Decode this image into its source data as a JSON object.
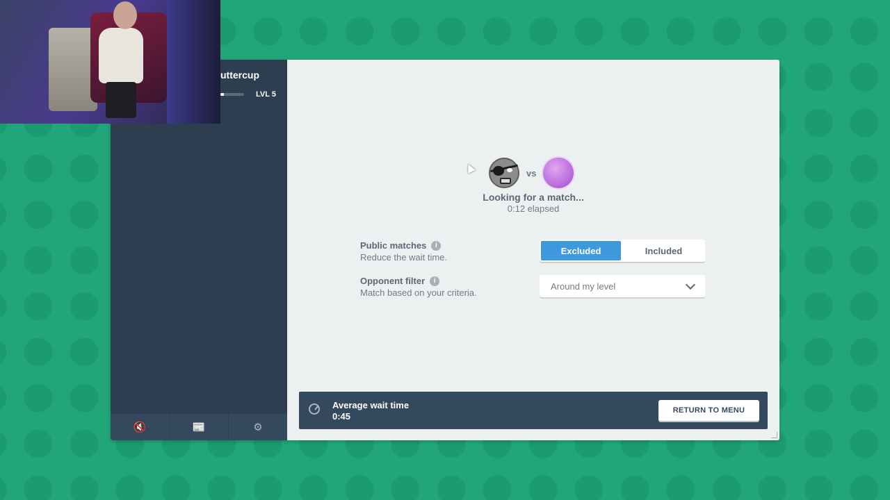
{
  "sidebar": {
    "profile_name": "uttercup",
    "level": "LVL 5",
    "xp_progress": 0.15,
    "footer": [
      {
        "icon": "mute-icon",
        "glyph": "🔇"
      },
      {
        "icon": "news-icon",
        "glyph": "📰"
      },
      {
        "icon": "gear-icon",
        "glyph": "⚙"
      }
    ]
  },
  "matchup": {
    "vs": "vs",
    "status": "Looking for a match...",
    "elapsed": "0:12 elapsed"
  },
  "options": {
    "public_matches": {
      "label": "Public matches",
      "desc": "Reduce the wait time.",
      "choices": [
        "Excluded",
        "Included"
      ],
      "selected": "Excluded"
    },
    "opponent_filter": {
      "label": "Opponent filter",
      "desc": "Match based on your criteria.",
      "value": "Around my level"
    },
    "info_glyph": "i"
  },
  "footer_bar": {
    "title": "Average wait time",
    "value": "0:45",
    "return_label": "RETURN TO MENU"
  },
  "colors": {
    "background": "#21a67a",
    "sidebar": "#2d3e50",
    "accent": "#3d99dc"
  }
}
